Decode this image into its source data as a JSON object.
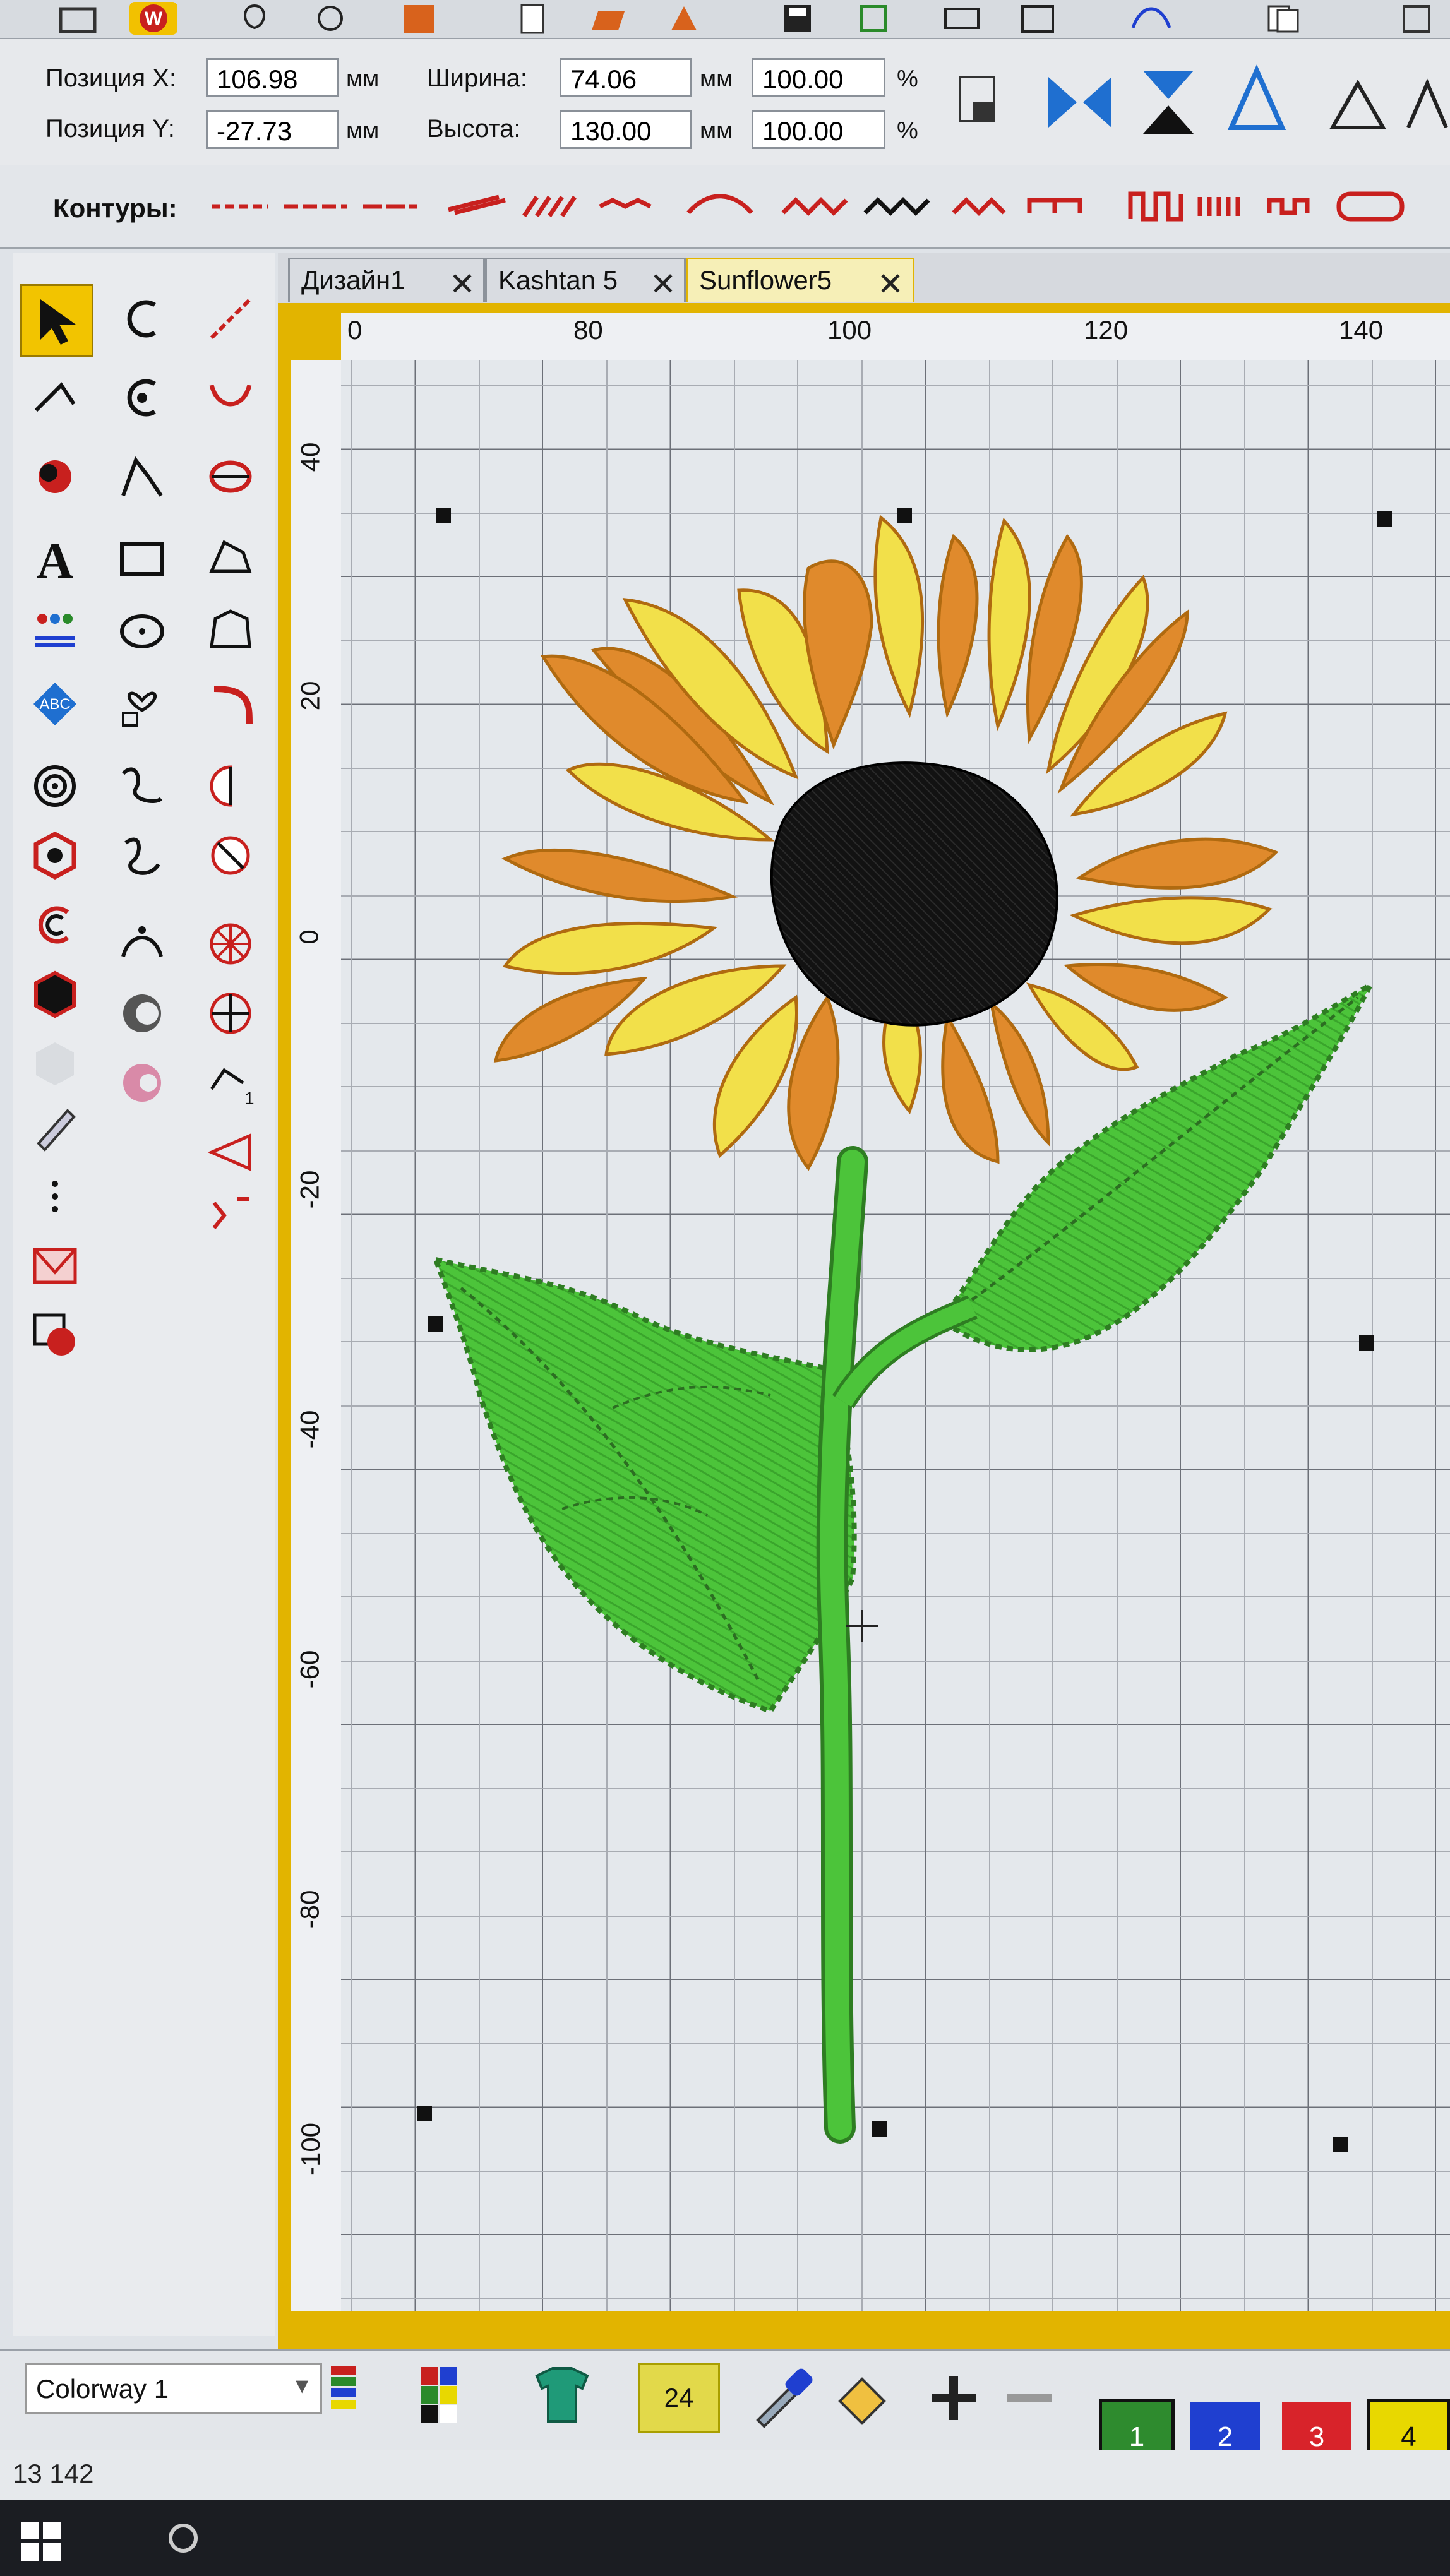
{
  "property_bar": {
    "pos_x_label": "Позиция X:",
    "pos_x_value": "106.98",
    "pos_y_label": "Позиция Y:",
    "pos_y_value": "-27.73",
    "width_label": "Ширина:",
    "width_value": "74.06",
    "height_label": "Высота:",
    "height_value": "130.00",
    "unit_mm": "мм",
    "scale_w": "100.00",
    "scale_h": "100.00",
    "unit_pct": "%"
  },
  "contours_label": "Контуры:",
  "tabs": [
    {
      "label": "Дизайн1",
      "active": false
    },
    {
      "label": "Kashtan 5",
      "active": false
    },
    {
      "label": "Sunflower5",
      "active": true
    }
  ],
  "ruler": {
    "h_ticks": [
      "80",
      "100",
      "120",
      "140"
    ],
    "v_ticks": [
      "40",
      "20",
      "0",
      "-20",
      "-40",
      "-60",
      "-80",
      "-100"
    ]
  },
  "bottom": {
    "colorway": "Colorway 1",
    "stitch_color_count": "24",
    "swatches": [
      {
        "label": "1",
        "color": "#2e8b2e"
      },
      {
        "label": "2",
        "color": "#1f3fd0"
      },
      {
        "label": "3",
        "color": "#d8232a"
      },
      {
        "label": "4",
        "color": "#e8d800"
      }
    ]
  },
  "status": {
    "coords": "13 142"
  },
  "colors": {
    "accent": "#e2b400",
    "petal_yellow": "#f2e04a",
    "petal_orange": "#e08a2c",
    "center": "#111111",
    "leaf": "#4fc43a"
  }
}
